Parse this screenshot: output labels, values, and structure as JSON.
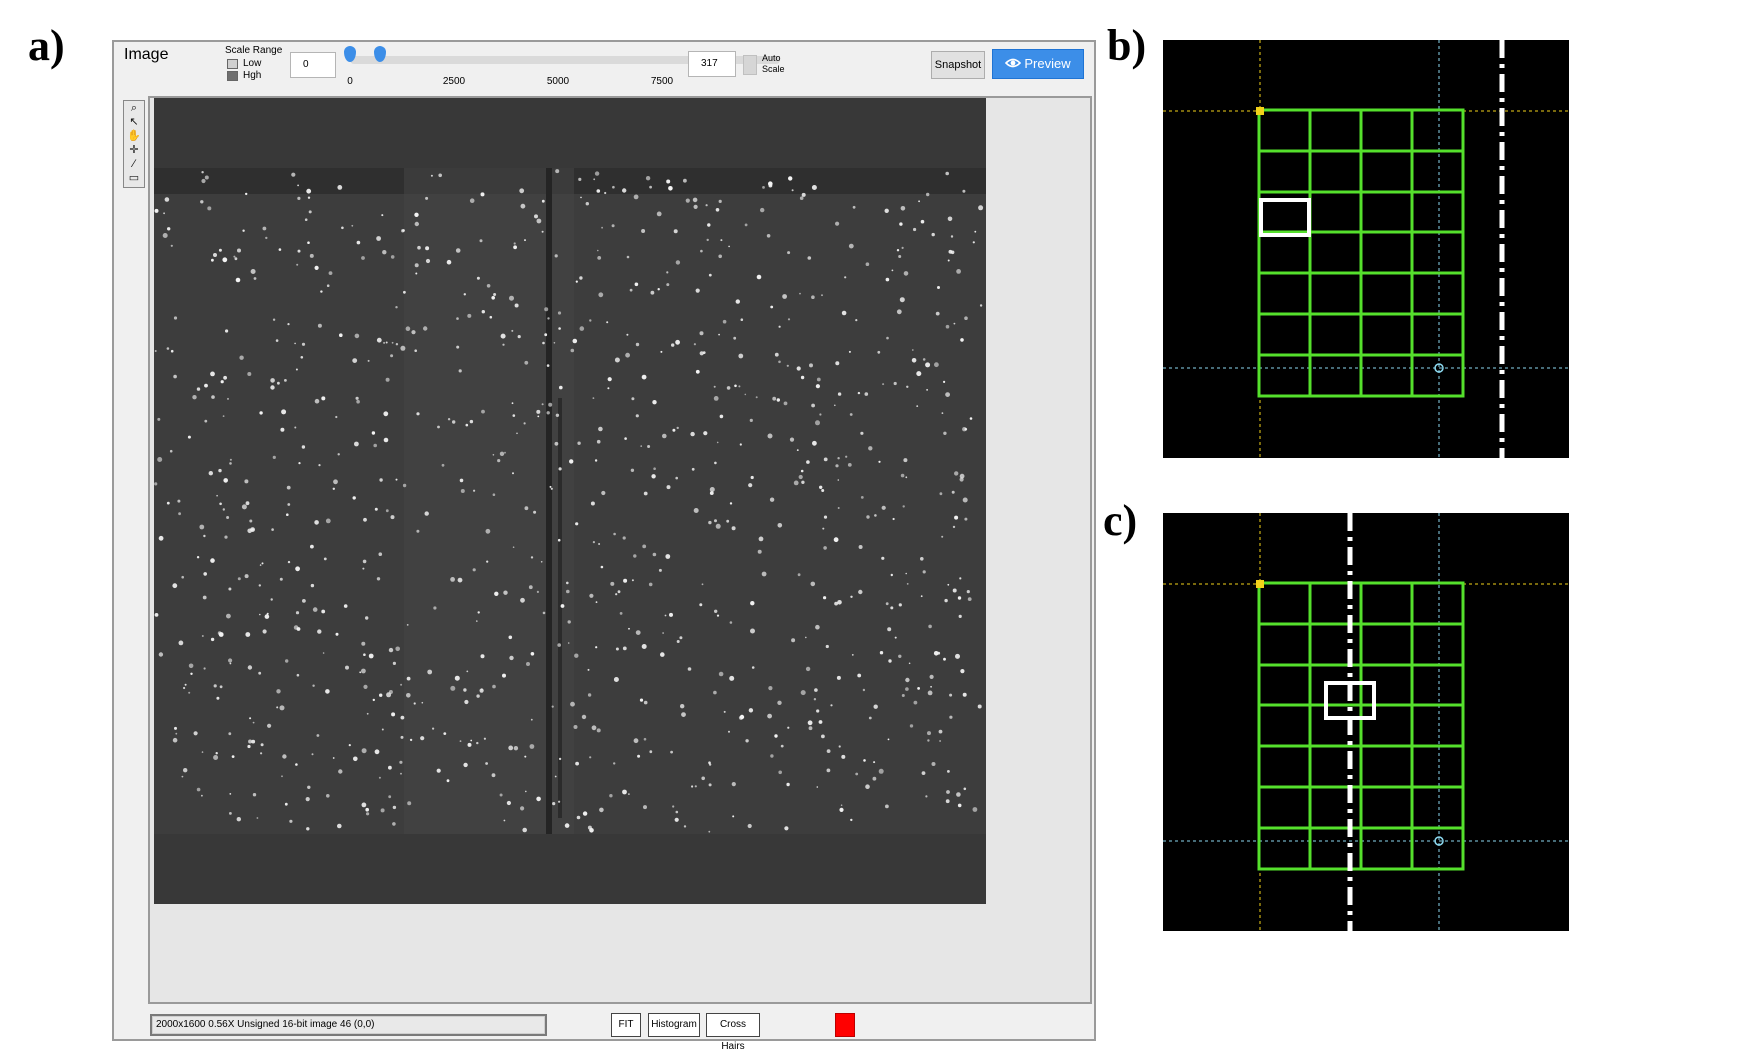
{
  "panels": {
    "a": "a)",
    "b": "b)",
    "c": "c)"
  },
  "window": {
    "title": "Image",
    "scale_range": {
      "label": "Scale Range",
      "low": "Low",
      "high": "Hgh"
    },
    "min_value": "0",
    "max_value": "317",
    "slider": {
      "ticks": [
        "0",
        "2500",
        "5000",
        "7500"
      ],
      "low_value": 0,
      "high_value": 317,
      "max": 7500
    },
    "auto_scale": {
      "line1": "Auto",
      "line2": "Scale"
    },
    "snapshot_label": "Snapshot",
    "preview_label": "Preview",
    "tools": [
      "zoom-icon",
      "pointer-icon",
      "pan-hand-icon",
      "crosshair-icon",
      "line-icon",
      "rectangle-icon"
    ],
    "status_text": "2000x1600 0.56X Unsigned 16-bit image 46    (0,0)",
    "bottom_buttons": {
      "fit": "FIT",
      "histogram": "Histogram",
      "crosshairs": "Cross Hairs"
    },
    "colors": {
      "accent": "#3c8ee8",
      "swatch": "#ff0000",
      "grid": "#55e02c",
      "marker_yellow": "#f2d21a",
      "marker_cyan": "#8cd9f0"
    }
  }
}
